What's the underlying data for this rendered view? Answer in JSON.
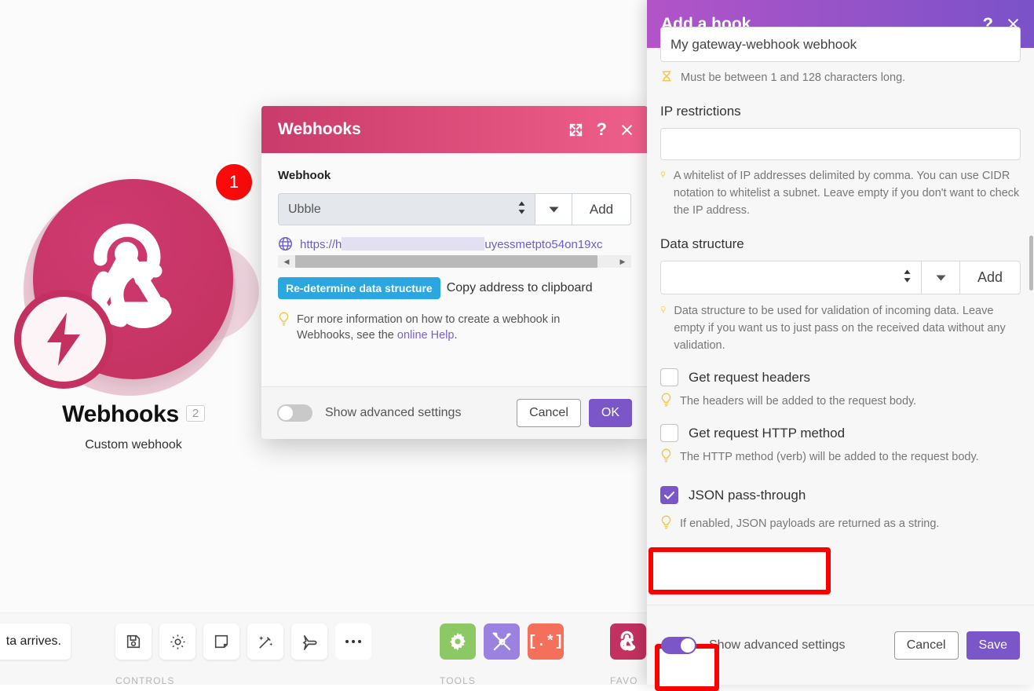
{
  "module_card": {
    "title": "Webhooks",
    "module_number": "2",
    "subtitle": "Custom webhook",
    "error_badge": "1",
    "brand_color": "#c2315f",
    "badge_color": "#fa0a0a"
  },
  "toolbar": {
    "tooltip_text": "ta arrives.",
    "groups": [
      {
        "label": "CONTROLS",
        "icons": [
          "save-icon",
          "gear-icon",
          "note-icon",
          "magic-wand-icon",
          "airplane-icon",
          "more-icon"
        ]
      },
      {
        "label": "TOOLS",
        "icons": [
          "gear-tool-icon",
          "tools-icon",
          "regex-icon"
        ]
      },
      {
        "label": "FAVO",
        "icons": [
          "webhook-favorite-icon"
        ]
      }
    ]
  },
  "webhooks_modal": {
    "title": "Webhooks",
    "header_color": "#c93b6a",
    "icons": {
      "expand": "expand-icon",
      "help": "help-icon",
      "close": "close-icon"
    },
    "field_label": "Webhook",
    "select_value": "Ubble",
    "add_label": "Add",
    "url_prefix": "https://h",
    "url_suffix": "uyessmetpto54on19xc",
    "redetermine_label": "Re-determine data structure",
    "copy_label": "Copy address to clipboard",
    "hint_text": "For more information on how to create a webhook in Webhooks, see the ",
    "hint_link": "online Help",
    "hint_tail": ".",
    "footer": {
      "toggle_label": "Show advanced settings",
      "toggle_on": false,
      "cancel": "Cancel",
      "confirm": "OK"
    }
  },
  "hook_panel": {
    "title": "Add a hook",
    "header_color": "#b254c8",
    "icons": {
      "help": "help-icon",
      "close": "close-icon"
    },
    "name_value": "My gateway-webhook webhook",
    "name_hint": "Must be between 1 and 128 characters long.",
    "ip_label": "IP restrictions",
    "ip_value": "",
    "ip_hint": "A whitelist of IP addresses delimited by comma. You can use CIDR notation to whitelist a subnet. Leave empty if you don't want to check the IP address.",
    "ds_label": "Data structure",
    "ds_value": "",
    "ds_add_label": "Add",
    "ds_hint": "Data structure to be used for validation of incoming data. Leave empty if you want us to just pass on the received data without any validation.",
    "checkboxes": [
      {
        "label": "Get request headers",
        "checked": false,
        "hint": "The headers will be added to the request body.",
        "highlighted": false
      },
      {
        "label": "Get request HTTP method",
        "checked": false,
        "hint": "The HTTP method (verb) will be added to the request body.",
        "highlighted": false
      },
      {
        "label": "JSON pass-through",
        "checked": true,
        "hint": "If enabled, JSON payloads are returned as a string.",
        "highlighted": true
      }
    ],
    "footer": {
      "toggle_label": "Show advanced settings",
      "toggle_on": true,
      "toggle_highlighted": true,
      "cancel": "Cancel",
      "confirm": "Save"
    }
  },
  "annotations": {
    "highlight_color": "#fb0000"
  }
}
